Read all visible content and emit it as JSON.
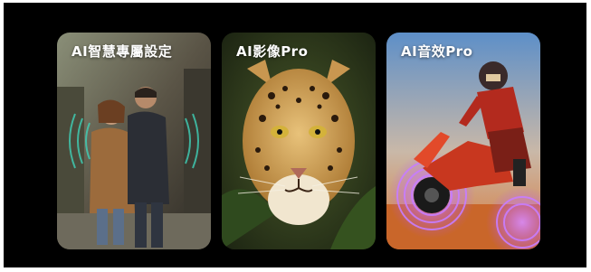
{
  "cards": [
    {
      "title": "AI智慧專屬設定",
      "icon": "couple-walking-street-image"
    },
    {
      "title": "AI影像Pro",
      "icon": "leopard-portrait-image"
    },
    {
      "title": "AI音效Pro",
      "icon": "motocross-rider-image"
    }
  ],
  "colors": {
    "background": "#000000",
    "page": "#ffffff",
    "title_text": "#ffffff",
    "glow_teal": "#3fd1b8",
    "glow_purple": "#b04cff"
  }
}
